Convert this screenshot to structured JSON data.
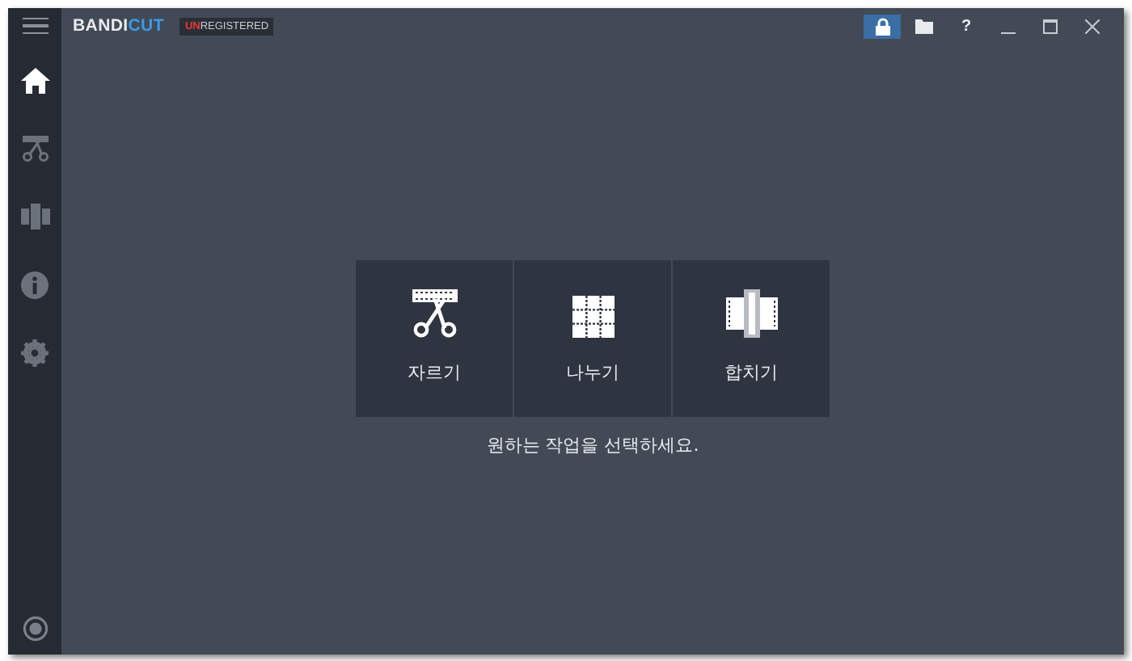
{
  "app": {
    "logo_part_1": "BANDI",
    "logo_part_2": "CUT",
    "badge_part_1": "UN",
    "badge_part_2": "REGISTERED"
  },
  "title_buttons": [
    {
      "kind": "lock",
      "selected": true
    },
    {
      "kind": "folder",
      "selected": false
    },
    {
      "kind": "help",
      "label": "?",
      "selected": false
    },
    {
      "kind": "minimize",
      "selected": false
    },
    {
      "kind": "maximize",
      "selected": false
    },
    {
      "kind": "close",
      "selected": false
    }
  ],
  "sidebar": {
    "items": [
      {
        "kind": "home",
        "selected": true
      },
      {
        "kind": "cut",
        "selected": false
      },
      {
        "kind": "join",
        "selected": false
      },
      {
        "kind": "info",
        "selected": false
      },
      {
        "kind": "settings",
        "selected": false
      }
    ]
  },
  "tiles": [
    {
      "kind": "cut",
      "label": "자르기"
    },
    {
      "kind": "split",
      "label": "나누기"
    },
    {
      "kind": "join",
      "label": "합치기"
    }
  ],
  "prompt": "원하는 작업을 선택하세요."
}
